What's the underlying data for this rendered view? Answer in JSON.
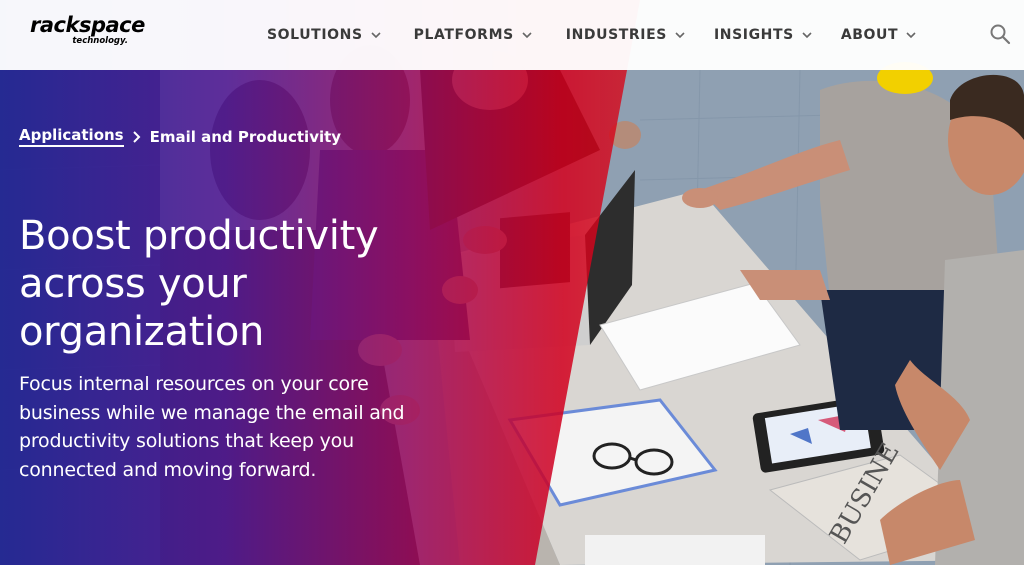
{
  "header": {
    "logo_text": "rackspace",
    "logo_sub": "technology.",
    "nav": [
      {
        "label": "SOLUTIONS"
      },
      {
        "label": "PLATFORMS"
      },
      {
        "label": "INDUSTRIES"
      },
      {
        "label": "INSIGHTS"
      },
      {
        "label": "ABOUT"
      }
    ],
    "search_icon": "search-icon"
  },
  "breadcrumb": {
    "parent": "Applications",
    "current": "Email and Productivity"
  },
  "hero": {
    "headline_lines": [
      "Boost productivity",
      "across your",
      "organization"
    ],
    "subtext": "Focus internal resources on your core business while we manage the email and productivity solutions that keep you connected and moving forward."
  },
  "colors": {
    "brand_red": "#d7001e",
    "brand_blue": "#242896",
    "brand_purple": "#541a96",
    "nav_text": "#3a3a3a"
  }
}
